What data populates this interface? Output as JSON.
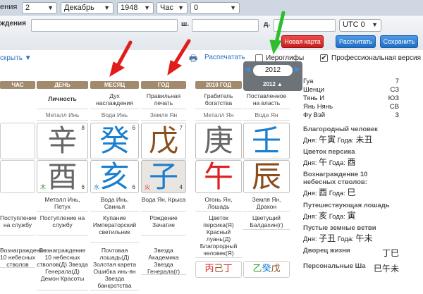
{
  "top": {
    "label_month_partial": "ения",
    "day": "2",
    "month": "Декабрь",
    "year": "1948",
    "hour_label": "Час",
    "hour": "0"
  },
  "form": {
    "place_label": "ждения",
    "sh_label": "ш.",
    "d_label": "д.",
    "tz": "UTC 0",
    "new_card": "Новая карта",
    "calculate": "Рассчитать",
    "save": "Сохранить"
  },
  "toolbar": {
    "expand": "скрыть ▼",
    "print": "Распечатать",
    "hieroglyphs": "Иероглифы",
    "pro": "Профессиональная версия",
    "pro_checked": true
  },
  "columns": [
    "ЧАС",
    "ДЕНЬ",
    "МЕСЯЦ",
    "ГОД",
    "2010 ГОД",
    "2012"
  ],
  "year_selector": "2012",
  "row_top": [
    [
      "",
      "Личность",
      "Дух наслаждения",
      "Правильная печать",
      "Грабитель богатства",
      "Поставленное на власть"
    ]
  ],
  "row_elem": [
    "",
    "Металл Инь",
    "Вода Инь",
    "Земля Ян",
    "Металл Ян",
    "Вода Ян"
  ],
  "stems": {
    "day": {
      "c": "辛",
      "n": "8"
    },
    "month": {
      "c": "癸",
      "n": "6"
    },
    "year": {
      "c": "戊",
      "n": "7"
    },
    "y2010": {
      "c": "庚"
    },
    "y2012": {
      "c": "壬"
    }
  },
  "branches": {
    "day": {
      "c": "酉",
      "n": "6",
      "s": "木"
    },
    "month": {
      "c": "亥",
      "n": "6",
      "s": "水"
    },
    "year": {
      "c": "子",
      "n": "4",
      "s": "火"
    },
    "y2010": {
      "c": "午"
    },
    "y2012": {
      "c": "辰"
    }
  },
  "branch_names": [
    "",
    "Металл Инь, Петух",
    "Вода Инь, Свинья",
    "Вода Ян, Крыса",
    "Огонь Ян, Лошадь",
    "Земля Ян, Дракон"
  ],
  "stars1": [
    "Поступление на службу",
    "Купание Императорский светильник",
    "Рождение Зачатие",
    "Цветок персика(Я) Красный луань(Д) Благородный человек(Я)",
    "Цветущий Балдахин(г)"
  ],
  "stars2": [
    "Вознаграждение 10 небесных стволов(Д) Звезда Генерала(Д) Демон Красоты",
    "Почтовая лошадь(Д) Золотая карета Ошибка инь-ян Звезда банкротства",
    "Звезда Академика Звезда Генерала(г)"
  ],
  "hour_col": [
    "Поступление на службу",
    "Вознаграждение 10 небесных стволов"
  ],
  "hidden2010": [
    "丙",
    "己",
    "丁"
  ],
  "hidden2012": [
    "乙",
    "癸",
    "戊"
  ],
  "right": {
    "gua_label": "Гуа",
    "gua": "7",
    "rows": [
      [
        "Шенци",
        "СЗ"
      ],
      [
        "Тянь И",
        "ЮЗ"
      ],
      [
        "Янь Нянь",
        "СВ"
      ],
      [
        "Фу Вэй",
        "З"
      ]
    ],
    "sections": [
      {
        "title": "Благородный человек",
        "day": "午寅",
        "year": "未丑"
      },
      {
        "title": "Цветок персика",
        "day": "午",
        "year": "酉"
      },
      {
        "title": "Вознаграждение 10 небесных стволов:",
        "day": "酉",
        "year": "巳"
      },
      {
        "title": "Путешествующая лошадь",
        "day": "亥",
        "year": "寅"
      },
      {
        "title": "Пустые земные ветви",
        "day": "子丑",
        "year": "午未"
      }
    ],
    "day_label": "Дня:",
    "year_label": "Года:",
    "palace_label": "Дворец жизни",
    "palace": "丁巳",
    "personal_label": "Персональные Ша",
    "personal": "巳午未"
  }
}
